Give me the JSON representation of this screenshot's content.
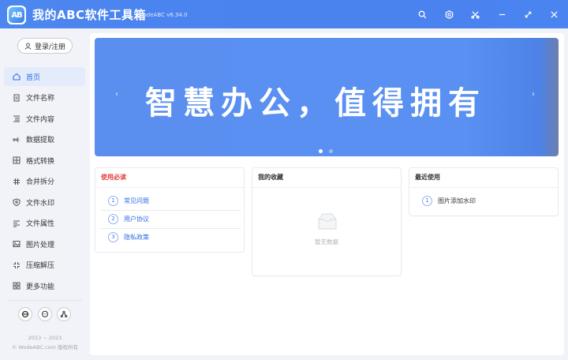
{
  "app": {
    "logo_text": "AB",
    "title": "我的ABC软件工具箱",
    "version": "WodeABC v6.34.0",
    "brand_color": "#4a84ef"
  },
  "titlebar_icons": [
    "search-icon",
    "settings-icon",
    "tools-icon",
    "minimize-icon",
    "maximize-icon",
    "close-icon"
  ],
  "sidebar": {
    "login_label": "登录/注册",
    "items": [
      {
        "label": "首页",
        "icon": "home-icon",
        "active": true
      },
      {
        "label": "文件名称",
        "icon": "file-name-icon"
      },
      {
        "label": "文件内容",
        "icon": "file-content-icon"
      },
      {
        "label": "数据提取",
        "icon": "data-extract-icon"
      },
      {
        "label": "格式转换",
        "icon": "format-convert-icon"
      },
      {
        "label": "合并拆分",
        "icon": "merge-split-icon"
      },
      {
        "label": "文件水印",
        "icon": "watermark-icon"
      },
      {
        "label": "文件属性",
        "icon": "file-attr-icon"
      },
      {
        "label": "图片处理",
        "icon": "image-icon"
      },
      {
        "label": "压缩解压",
        "icon": "compress-icon"
      },
      {
        "label": "更多功能",
        "icon": "more-icon"
      }
    ],
    "social_icons": [
      "browser-icon",
      "chat-icon",
      "share-icon"
    ],
    "footer_years": "2013 ~ 2023",
    "footer_copyright": "© WodeABC.com 版权所有"
  },
  "banner": {
    "text": "智慧办公，值得拥有",
    "slide_count": 2,
    "active_slide": 1
  },
  "cards": {
    "must_read": {
      "title": "使用必读",
      "items": [
        {
          "num": "1",
          "label": "常见问题"
        },
        {
          "num": "2",
          "label": "用户协议"
        },
        {
          "num": "3",
          "label": "隐私政策"
        }
      ]
    },
    "favorites": {
      "title": "我的收藏",
      "empty_text": "暂无数据"
    },
    "recent": {
      "title": "最近使用",
      "items": [
        {
          "num": "1",
          "label": "图片添加水印"
        }
      ]
    }
  }
}
